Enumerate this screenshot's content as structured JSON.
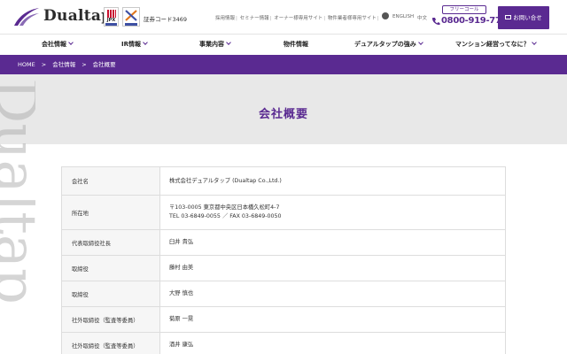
{
  "header": {
    "logo": "Dualtap",
    "jpx_label": "JPX",
    "stock_code": "証券コード3469",
    "utility_links": [
      "採用情報",
      "セミナー情報",
      "オーナー様専用サイト",
      "物件業者様専用サイト"
    ],
    "languages": [
      "ENGLISH",
      "中文"
    ],
    "freecall_label": "フリーコール",
    "phone": "0800-919-7779",
    "contact_label": "お問い合せ"
  },
  "nav": {
    "items": [
      {
        "label": "会社情報",
        "dropdown": true
      },
      {
        "label": "IR情報",
        "dropdown": true
      },
      {
        "label": "事業内容",
        "dropdown": true
      },
      {
        "label": "物件情報",
        "dropdown": false
      },
      {
        "label": "デュアルタップの強み",
        "dropdown": true
      },
      {
        "label": "マンション経営ってなに？",
        "dropdown": true
      }
    ]
  },
  "breadcrumb": [
    "HOME",
    "会社情報",
    "会社概要"
  ],
  "page": {
    "title": "会社概要",
    "watermark": "Dualtap"
  },
  "table": {
    "rows": [
      {
        "key": "会社名",
        "lines": [
          "株式会社デュアルタップ (Dualtap Co.,Ltd.)"
        ]
      },
      {
        "key": "所在地",
        "lines": [
          "〒103-0005 東京都中央区日本橋久松町4-7",
          "TEL 03-6849-0055 ／ FAX 03-6849-0050"
        ]
      },
      {
        "key": "代表取締役社長",
        "lines": [
          "臼井 貴弘"
        ]
      },
      {
        "key": "取締役",
        "lines": [
          "藤村 由美"
        ]
      },
      {
        "key": "取締役",
        "lines": [
          "大野 慎也"
        ]
      },
      {
        "key": "社外取締役（監査等委員）",
        "lines": [
          "菊原 一晃"
        ]
      },
      {
        "key": "社外取締役（監査等委員）",
        "lines": [
          "酒井 康弘"
        ]
      }
    ]
  },
  "colors": {
    "brand": "#5a2a91",
    "band": "#e8e8e8",
    "key_bg": "#f6f6f6"
  }
}
